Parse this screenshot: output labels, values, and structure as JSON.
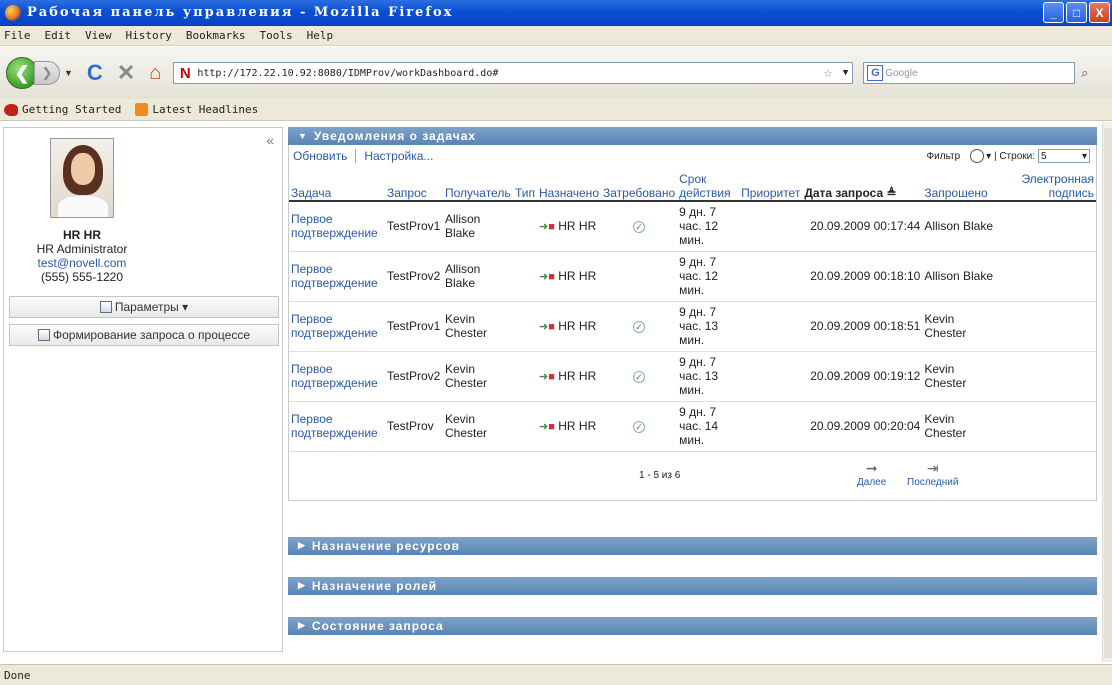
{
  "window": {
    "title": "Рабочая панель управления - Mozilla Firefox",
    "min": "_",
    "max": "□",
    "close": "X"
  },
  "menu": [
    "File",
    "Edit",
    "View",
    "History",
    "Bookmarks",
    "Tools",
    "Help"
  ],
  "nav": {
    "url": "http://172.22.10.92:8080/IDMProv/workDashboard.do#",
    "search_placeholder": "Google"
  },
  "bookmarks": [
    "Getting Started",
    "Latest Headlines"
  ],
  "user": {
    "name": "HR HR",
    "role": "HR Administrator",
    "email": "test@novell.com",
    "phone": "(555) 555-1220",
    "params_label": "Параметры",
    "request_label": "Формирование запроса о процессе"
  },
  "tasks_section": {
    "title": "Уведомления о задачах",
    "refresh": "Обновить",
    "settings": "Настройка...",
    "filter": "Фильтр",
    "rows_label": "Строки:",
    "rows_value": "5",
    "columns": [
      "Задача",
      "Запрос",
      "Получатель",
      "Тип",
      "Назначено",
      "Затребовано",
      "Срок действия",
      "Приоритет",
      "Дата запроса ≜",
      "Запрошено",
      "Электронная подпись"
    ],
    "rows": [
      {
        "task": "Первое подтверждение",
        "request": "TestProv1",
        "recipient": "Allison Blake",
        "assigned": "HR HR",
        "claimed": true,
        "due": "9 дн. 7 час. 12 мин.",
        "date": "20.09.2009 00:17:44",
        "requested_by": "Allison Blake"
      },
      {
        "task": "Первое подтверждение",
        "request": "TestProv2",
        "recipient": "Allison Blake",
        "assigned": "HR HR",
        "claimed": false,
        "due": "9 дн. 7 час. 12 мин.",
        "date": "20.09.2009 00:18:10",
        "requested_by": "Allison Blake"
      },
      {
        "task": "Первое подтверждение",
        "request": "TestProv1",
        "recipient": "Kevin Chester",
        "assigned": "HR HR",
        "claimed": true,
        "due": "9 дн. 7 час. 13 мин.",
        "date": "20.09.2009 00:18:51",
        "requested_by": "Kevin Chester"
      },
      {
        "task": "Первое подтверждение",
        "request": "TestProv2",
        "recipient": "Kevin Chester",
        "assigned": "HR HR",
        "claimed": true,
        "due": "9 дн. 7 час. 13 мин.",
        "date": "20.09.2009 00:19:12",
        "requested_by": "Kevin Chester"
      },
      {
        "task": "Первое подтверждение",
        "request": "TestProv",
        "recipient": "Kevin Chester",
        "assigned": "HR HR",
        "claimed": true,
        "due": "9 дн. 7 час. 14 мин.",
        "date": "20.09.2009 00:20:04",
        "requested_by": "Kevin Chester"
      }
    ],
    "pager_count": "1 - 5 из 6",
    "next": "Далее",
    "last": "Последний"
  },
  "sections": [
    "Назначение ресурсов",
    "Назначение ролей",
    "Состояние запроса"
  ],
  "status": "Done",
  "colors": {
    "header": "#5a84b3",
    "link": "#2a5aa8",
    "titlebar": "#0a4fd4"
  }
}
